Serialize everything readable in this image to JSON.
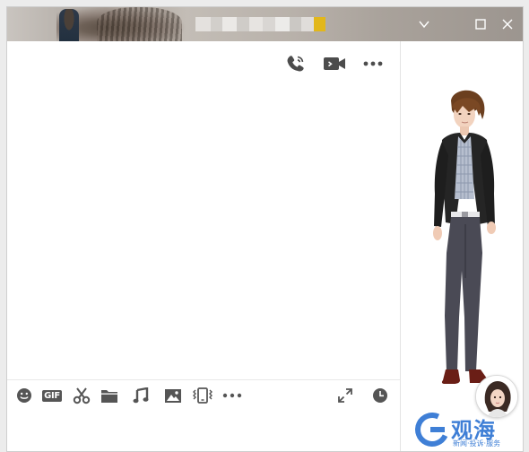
{
  "window": {
    "title_redacted": true,
    "accent_color": "#e2b71a"
  },
  "titlebar": {
    "pixel_colors": [
      "#e4e1de",
      "#d2cfcb",
      "#ebe9e6",
      "#cfccc8",
      "#e7e4e1",
      "#d9d6d3",
      "#ecebe9",
      "#cbc8c4",
      "#e0ddda"
    ]
  },
  "window_controls": {
    "collapse_icon": "chevron-down-icon",
    "maximize_icon": "maximize-icon",
    "close_icon": "close-icon"
  },
  "chat_header": {
    "icons": [
      "phone-call-icon",
      "video-call-icon",
      "more-icon"
    ]
  },
  "toolbar": {
    "icons": [
      "emoji-icon",
      "gif-icon",
      "scissors-icon",
      "folder-icon",
      "music-icon",
      "image-icon",
      "shake-icon",
      "more-icon",
      "expand-icon",
      "history-icon"
    ],
    "gif_label": "GIF"
  },
  "watermark": {
    "brand": "观海",
    "tagline": "新闻·投诉·服务"
  }
}
